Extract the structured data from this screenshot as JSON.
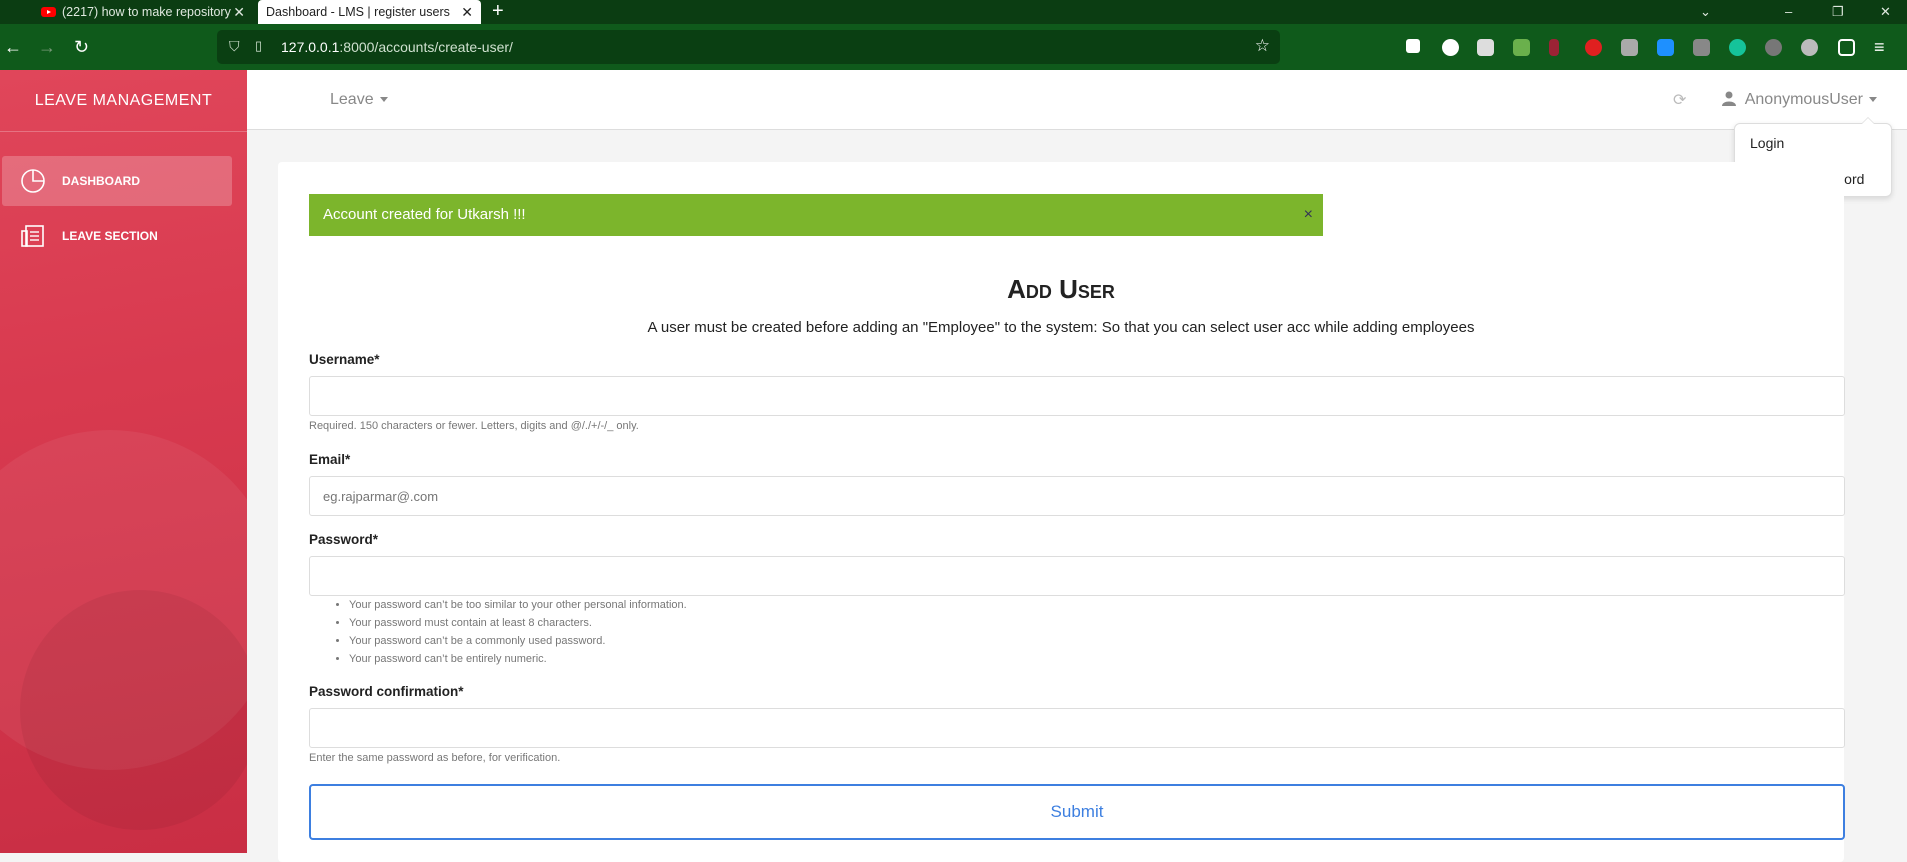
{
  "browser": {
    "tabs": [
      {
        "title": "(2217) how to make repository"
      },
      {
        "title": "Dashboard - LMS | register users"
      }
    ],
    "url_host": "127.0.0.1",
    "url_rest": ":8000/accounts/create-user/"
  },
  "sidebar": {
    "brand": "LEAVE MANAGEMENT",
    "items": [
      {
        "label": "DASHBOARD",
        "icon": "pie-chart-icon"
      },
      {
        "label": "LEAVE SECTION",
        "icon": "document-icon"
      }
    ]
  },
  "header": {
    "leave_menu": "Leave",
    "user": "AnonymousUser",
    "dropdown": [
      "Login",
      "Change Password"
    ]
  },
  "alert": {
    "text": "Account created for Utkarsh !!!",
    "close": "×"
  },
  "form": {
    "title": "Add User",
    "subtitle": "A user must be created before adding an \"Employee\" to the system: So that you can select user acc while adding employees",
    "username_label": "Username*",
    "username_help": "Required. 150 characters or fewer. Letters, digits and @/./+/-/_ only.",
    "email_label": "Email*",
    "email_placeholder": "eg.rajparmar@.com",
    "password_label": "Password*",
    "password_rules": [
      "Your password can’t be too similar to your other personal information.",
      "Your password must contain at least 8 characters.",
      "Your password can’t be a commonly used password.",
      "Your password can’t be entirely numeric."
    ],
    "password_confirm_label": "Password confirmation*",
    "password_confirm_help": "Enter the same password as before, for verification.",
    "submit": "Submit"
  },
  "colors": {
    "sidebar": "#d83a4f",
    "alert": "#7cb52c",
    "submit": "#3d7fe0",
    "browser": "#0f5a1b"
  }
}
